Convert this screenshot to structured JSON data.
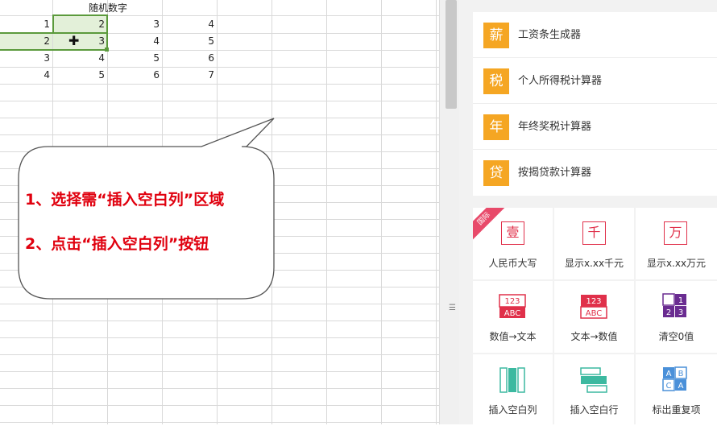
{
  "sheet": {
    "header": "随机数字",
    "rows": [
      [
        "1",
        "2",
        "3",
        "4"
      ],
      [
        "2",
        "3",
        "4",
        "5"
      ],
      [
        "3",
        "4",
        "5",
        "6"
      ],
      [
        "4",
        "5",
        "6",
        "7"
      ]
    ]
  },
  "callout": {
    "line1": "1、选择需“插入空白列”区域",
    "line2": "2、点击“插入空白列”按钮",
    "color": "#e0000e"
  },
  "calculators": [
    {
      "icon": "薪",
      "label": "工资条生成器"
    },
    {
      "icon": "税",
      "label": "个人所得税计算器"
    },
    {
      "icon": "年",
      "label": "年终奖税计算器"
    },
    {
      "icon": "贷",
      "label": "按揭贷款计算器"
    }
  ],
  "tools": {
    "ribbon": "国际",
    "rmb": {
      "icon": "壹",
      "label": "人民币大写"
    },
    "qian": {
      "icon": "千",
      "label": "显示x.xx千元"
    },
    "wan": {
      "icon": "万",
      "label": "显示x.xx万元"
    },
    "num2text": {
      "label": "数值→文本"
    },
    "text2num": {
      "label": "文本→数值"
    },
    "clear0": {
      "label": "清空0值"
    },
    "insertcol": {
      "label": "插入空白列"
    },
    "insertrow": {
      "label": "插入空白行"
    },
    "dup": {
      "label": "标出重复项"
    }
  },
  "colors": {
    "accent": "#f5a623",
    "red": "#e0304a",
    "teal": "#3cb9a0",
    "purple": "#6a2c91",
    "blue": "#4a90d9"
  }
}
